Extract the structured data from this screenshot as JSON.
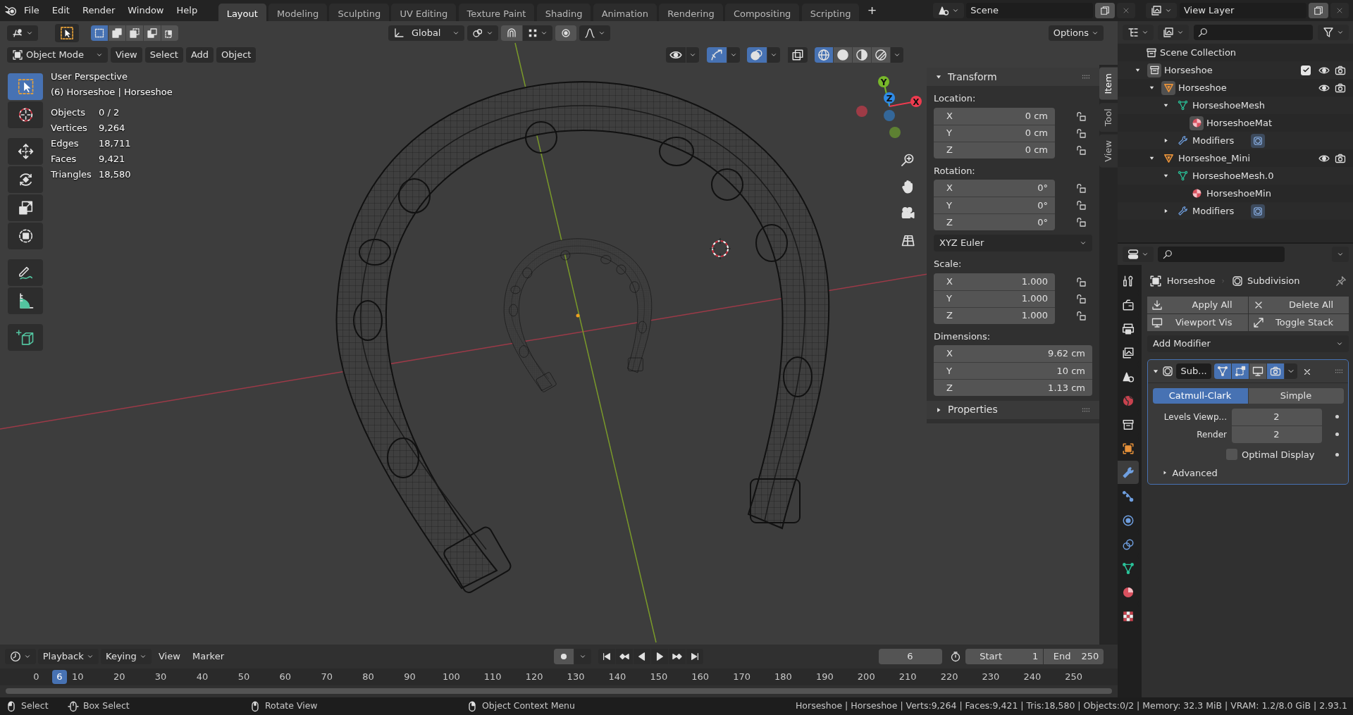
{
  "top_bar": {
    "menus": [
      "File",
      "Edit",
      "Render",
      "Window",
      "Help"
    ],
    "workspaces": [
      {
        "label": "Layout",
        "selected": true
      },
      {
        "label": "Modeling",
        "selected": false
      },
      {
        "label": "Sculpting",
        "selected": false
      },
      {
        "label": "UV Editing",
        "selected": false
      },
      {
        "label": "Texture Paint",
        "selected": false
      },
      {
        "label": "Shading",
        "selected": false
      },
      {
        "label": "Animation",
        "selected": false
      },
      {
        "label": "Rendering",
        "selected": false
      },
      {
        "label": "Compositing",
        "selected": false
      },
      {
        "label": "Scripting",
        "selected": false
      }
    ],
    "add_tab": "+",
    "scene": "Scene",
    "view_layer": "View Layer"
  },
  "viewport": {
    "select_modes": [
      {
        "kind": "set",
        "selected": true
      },
      {
        "kind": "extend",
        "selected": false
      },
      {
        "kind": "subtract",
        "selected": false
      },
      {
        "kind": "invert",
        "selected": false
      },
      {
        "kind": "intersect",
        "selected": false
      }
    ],
    "orientation": "Global",
    "options": "Options",
    "mode": "Object Mode",
    "menus": [
      "View",
      "Select",
      "Add",
      "Object"
    ],
    "toggles": [
      {
        "kind": "visibility",
        "on": false
      },
      {
        "kind": "gizmos",
        "on": true
      },
      {
        "kind": "overlays",
        "on": true
      },
      {
        "kind": "xray",
        "on": false
      }
    ],
    "shading": [
      {
        "kind": "wireframe",
        "selected": true
      },
      {
        "kind": "solid",
        "selected": false
      },
      {
        "kind": "material",
        "selected": false
      },
      {
        "kind": "rendered",
        "selected": false
      }
    ],
    "tools": [
      {
        "kind": "select_box",
        "selected": true
      },
      {
        "kind": "cursor",
        "selected": false
      },
      {
        "kind": "move",
        "selected": false
      },
      {
        "kind": "rotate",
        "selected": false
      },
      {
        "kind": "scale",
        "selected": false
      },
      {
        "kind": "transform",
        "selected": false
      },
      {
        "kind": "annotate",
        "selected": false
      },
      {
        "kind": "measure",
        "selected": false
      },
      {
        "kind": "add_cube",
        "selected": false
      }
    ],
    "overlay": {
      "title": "User Perspective",
      "subtitle": "(6) Horseshoe | Horseshoe",
      "stats": [
        {
          "label": "Objects",
          "value": "0 / 2"
        },
        {
          "label": "Vertices",
          "value": "9,264"
        },
        {
          "label": "Edges",
          "value": "18,711"
        },
        {
          "label": "Faces",
          "value": "9,421"
        },
        {
          "label": "Triangles",
          "value": "18,580"
        }
      ]
    },
    "gizmo": [
      {
        "label": "X",
        "color": "#ee3b4f"
      },
      {
        "label": "Y",
        "color": "#78b82a"
      },
      {
        "label": "Z",
        "color": "#2e8ae6"
      }
    ]
  },
  "sidebar": {
    "tabs": [
      {
        "label": "Item",
        "selected": true
      },
      {
        "label": "Tool",
        "selected": false
      },
      {
        "label": "View",
        "selected": false
      }
    ],
    "panel_title": "Transform",
    "expanded": true,
    "groups": [
      {
        "label": "Location:",
        "lockable": true,
        "fields": [
          {
            "axis": "X",
            "value": "0 cm",
            "locked": false
          },
          {
            "axis": "Y",
            "value": "0 cm",
            "locked": false
          },
          {
            "axis": "Z",
            "value": "0 cm",
            "locked": false
          }
        ]
      },
      {
        "label": "Rotation:",
        "lockable": true,
        "fields": [
          {
            "axis": "X",
            "value": "0°",
            "locked": false
          },
          {
            "axis": "Y",
            "value": "0°",
            "locked": false
          },
          {
            "axis": "Z",
            "value": "0°",
            "locked": false
          }
        ],
        "mode": "XYZ Euler"
      },
      {
        "label": "Scale:",
        "lockable": true,
        "fields": [
          {
            "axis": "X",
            "value": "1.000",
            "locked": false
          },
          {
            "axis": "Y",
            "value": "1.000",
            "locked": false
          },
          {
            "axis": "Z",
            "value": "1.000",
            "locked": false
          }
        ]
      },
      {
        "label": "Dimensions:",
        "lockable": false,
        "fields": [
          {
            "axis": "X",
            "value": "9.62 cm"
          },
          {
            "axis": "Y",
            "value": "10 cm"
          },
          {
            "axis": "Z",
            "value": "1.13 cm"
          }
        ]
      }
    ],
    "collapsed_panel": "Properties"
  },
  "outliner": {
    "root": "Scene Collection",
    "tree": [
      {
        "label": "Horseshoe",
        "kind": "collection",
        "active": true,
        "expanded": true,
        "checked": true,
        "toggles": true,
        "children": [
          {
            "label": "Horseshoe",
            "kind": "object",
            "active": true,
            "expanded": true,
            "toggles": true,
            "children": [
              {
                "label": "HorseshoeMesh",
                "kind": "mesh",
                "active": false,
                "expanded": true,
                "toggles": false,
                "children": [
                  {
                    "label": "HorseshoeMat",
                    "kind": "material",
                    "active": true,
                    "toggles": false
                  }
                ]
              },
              {
                "label": "Modifiers",
                "kind": "modifiers",
                "active": false,
                "expanded": false,
                "toggles": false
              }
            ]
          },
          {
            "label": "Horseshoe_Mini",
            "kind": "object",
            "active": false,
            "expanded": true,
            "toggles": true,
            "children": [
              {
                "label": "HorseshoeMesh.0",
                "kind": "mesh",
                "active": false,
                "expanded": true,
                "toggles": false,
                "children": [
                  {
                    "label": "HorseshoeMin",
                    "kind": "material",
                    "active": false,
                    "toggles": false
                  }
                ]
              },
              {
                "label": "Modifiers",
                "kind": "modifiers",
                "active": false,
                "expanded": false,
                "toggles": false
              }
            ]
          }
        ]
      }
    ]
  },
  "properties": {
    "tabs": [
      {
        "kind": "tool",
        "selected": false
      },
      {
        "kind": "render",
        "selected": false
      },
      {
        "kind": "output",
        "selected": false
      },
      {
        "kind": "view_layer",
        "selected": false
      },
      {
        "kind": "scene",
        "selected": false
      },
      {
        "kind": "world",
        "selected": false
      },
      {
        "kind": "collection",
        "selected": false
      },
      {
        "kind": "object",
        "selected": false
      },
      {
        "kind": "modifiers",
        "selected": true
      },
      {
        "kind": "particles",
        "selected": false
      },
      {
        "kind": "physics",
        "selected": false
      },
      {
        "kind": "constraints",
        "selected": false
      },
      {
        "kind": "data",
        "selected": false
      },
      {
        "kind": "material",
        "selected": false
      },
      {
        "kind": "texture",
        "selected": false
      }
    ],
    "object": "Horseshoe",
    "modifier_name": "Subdivision",
    "buttons": [
      {
        "label": "Apply All",
        "kind": "apply"
      },
      {
        "label": "Delete All",
        "kind": "delete"
      },
      {
        "label": "Viewport Vis",
        "kind": "viewport"
      },
      {
        "label": "Toggle Stack",
        "kind": "toggle"
      }
    ],
    "add_modifier": "Add Modifier",
    "modifier": {
      "name": "Sub...",
      "expanded": true,
      "toggles": [
        {
          "kind": "edit_mode",
          "on": true
        },
        {
          "kind": "cage",
          "on": true
        },
        {
          "kind": "viewport",
          "on": false
        },
        {
          "kind": "render",
          "on": true
        }
      ],
      "types": [
        {
          "label": "Catmull-Clark",
          "selected": true
        },
        {
          "label": "Simple",
          "selected": false
        }
      ],
      "fields": [
        {
          "label": "Levels Viewp...",
          "value": "2"
        },
        {
          "label": "Render",
          "value": "2"
        }
      ],
      "optimal_display": {
        "label": "Optimal Display",
        "checked": false
      },
      "advanced": {
        "label": "Advanced",
        "expanded": false
      }
    }
  },
  "timeline": {
    "menus": [
      "Playback",
      "Keying",
      "View",
      "Marker"
    ],
    "current_frame": "6",
    "playhead_frame": "6",
    "start_label": "Start",
    "start": "1",
    "end_label": "End",
    "end": "250",
    "ticks": [
      "0",
      "10",
      "20",
      "30",
      "40",
      "50",
      "60",
      "70",
      "80",
      "90",
      "100",
      "110",
      "120",
      "130",
      "140",
      "150",
      "160",
      "170",
      "180",
      "190",
      "200",
      "210",
      "220",
      "230",
      "240",
      "250"
    ]
  },
  "status_bar": {
    "hints": [
      {
        "label": "Select",
        "kind": "left"
      },
      {
        "label": "Box Select",
        "kind": "drag"
      },
      {
        "label": "Rotate View",
        "kind": "middle"
      },
      {
        "label": "Object Context Menu",
        "kind": "right"
      }
    ],
    "info": "Horseshoe | Horseshoe | Verts:9,264 | Faces:9,421 | Tris:18,580 | Objects:0/2 | Memory: 32.3 MiB | VRAM: 1.2/8.0 GiB | 2.93.1"
  }
}
